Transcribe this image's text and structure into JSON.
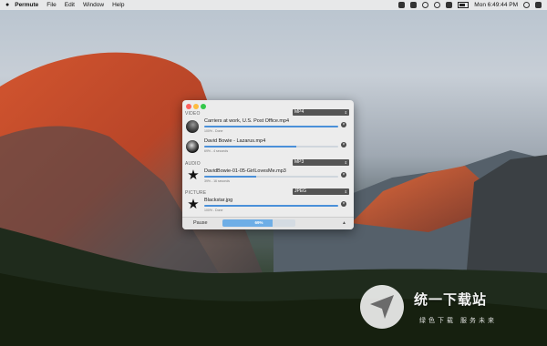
{
  "menubar": {
    "app_name": "Permute",
    "items": [
      "File",
      "Edit",
      "Window",
      "Help"
    ],
    "clock": "Mon 6:49:44 PM"
  },
  "app": {
    "sections": [
      {
        "name": "VIDEO",
        "format": "MP4"
      },
      {
        "name": "AUDIO",
        "format": "MP3"
      },
      {
        "name": "PICTURE",
        "format": "JPEG"
      }
    ],
    "items": [
      {
        "name": "Carriers at work, U.S. Post Office.mp4",
        "status": "100% - Done",
        "progress": 1.0,
        "thumb": "video-thumbnail"
      },
      {
        "name": "David Bowie - Lazarus.mp4",
        "status": "69% - 4 seconds",
        "progress": 0.69,
        "thumb": "video-thumbnail"
      },
      {
        "name": "DavidBowie-01-05-GirlLovesMe.mp3",
        "status": "39% - 16 seconds",
        "progress": 0.39,
        "thumb": "star-icon"
      },
      {
        "name": "Blackstar.jpg",
        "status": "100% - Done",
        "progress": 1.0,
        "thumb": "star-icon"
      }
    ],
    "pause_label": "Pause",
    "total_progress_label": "69%",
    "total_progress": 0.69
  },
  "watermark": {
    "main": "统一下载站",
    "sub": "绿色下载 服务未来"
  },
  "colors": {
    "accent": "#4a90d9",
    "close_red": "#fc605c",
    "min_yellow": "#fdbc40",
    "max_green": "#34c84a"
  }
}
